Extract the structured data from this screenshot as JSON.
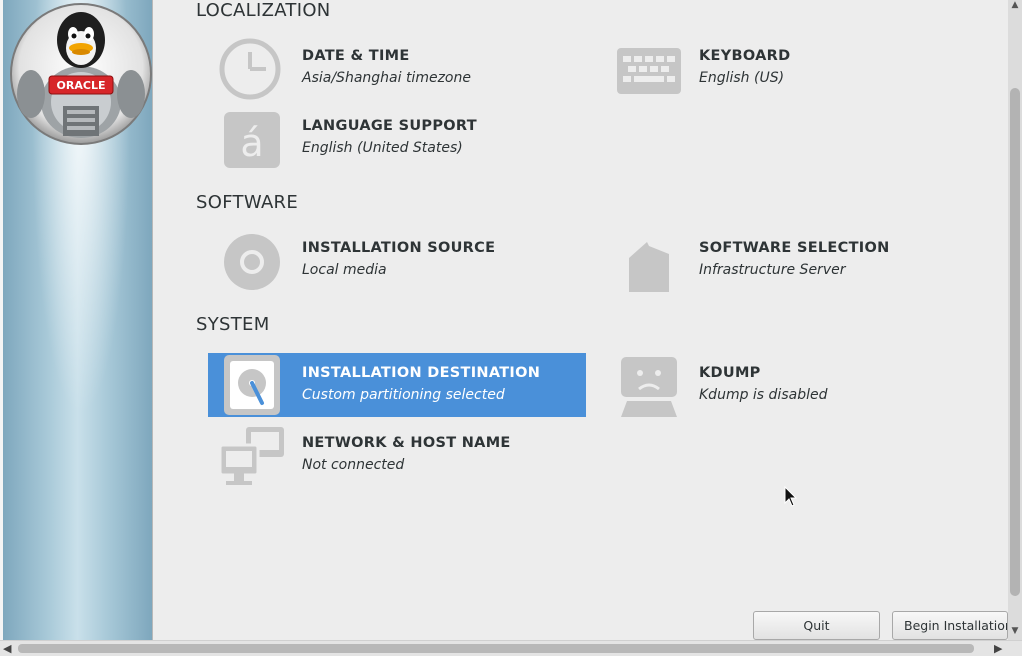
{
  "logo": {
    "text": "ORACLE"
  },
  "sections": {
    "localization": "LOCALIZATION",
    "software": "SOFTWARE",
    "system": "SYSTEM"
  },
  "spokes": {
    "date_time": {
      "title": "DATE & TIME",
      "status": "Asia/Shanghai timezone",
      "icon": "clock-icon"
    },
    "keyboard": {
      "title": "KEYBOARD",
      "status": "English (US)",
      "icon": "keyboard-icon"
    },
    "language": {
      "title": "LANGUAGE SUPPORT",
      "status": "English (United States)",
      "icon": "language-icon"
    },
    "install_source": {
      "title": "INSTALLATION SOURCE",
      "status": "Local media",
      "icon": "disc-icon"
    },
    "software_selection": {
      "title": "SOFTWARE SELECTION",
      "status": "Infrastructure Server",
      "icon": "package-icon"
    },
    "install_destination": {
      "title": "INSTALLATION DESTINATION",
      "status": "Custom partitioning selected",
      "icon": "harddisk-icon",
      "selected": true
    },
    "kdump": {
      "title": "KDUMP",
      "status": "Kdump is disabled",
      "icon": "kdump-icon"
    },
    "network": {
      "title": "NETWORK & HOST NAME",
      "status": "Not connected",
      "icon": "network-icon"
    }
  },
  "buttons": {
    "quit": "Quit",
    "begin": "Begin Installation"
  },
  "colors": {
    "selected_bg": "#4a90d9",
    "icon_gray": "#c6c6c6",
    "background": "#ededed"
  }
}
